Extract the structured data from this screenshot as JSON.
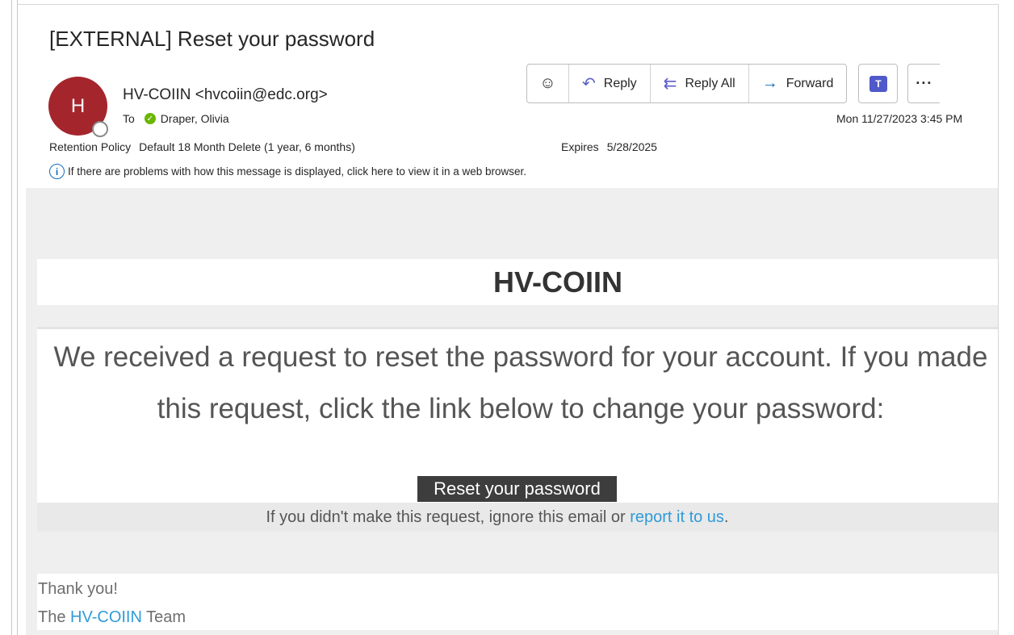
{
  "message": {
    "subject": "[EXTERNAL] Reset your password",
    "sender_initial": "H",
    "sender": "HV-COIIN <hvcoiin@edc.org>",
    "to_label": "To",
    "to_name": "Draper, Olivia",
    "date": "Mon 11/27/2023 3:45 PM",
    "retention_label": "Retention Policy",
    "retention_value": "Default 18 Month Delete (1 year, 6 months)",
    "expires_label": "Expires",
    "expires_value": "5/28/2025",
    "info_text": "If there are problems with how this message is displayed, click here to view it in a web browser."
  },
  "toolbar": {
    "reply_label": "Reply",
    "reply_all_label": "Reply All",
    "forward_label": "Forward",
    "more_label": "···"
  },
  "email_body": {
    "brand_title": "HV-COIIN",
    "main_text": "We received a request to reset the password for your account. If you made this request, click the link below to change your password:",
    "reset_link": "Reset your password",
    "ignore_prefix": "If you didn't make this request, ignore this email or ",
    "report_link": "report it to us",
    "ignore_suffix": ".",
    "thanks": "Thank you!",
    "team_prefix": "The ",
    "team_link": "HV-COIIN",
    "team_suffix": " Team"
  },
  "colors": {
    "avatar": "#a4262c",
    "link": "#2f9bd8",
    "reset_button": "#3d3d3d",
    "presence_check": "#6bb700"
  },
  "icons": [
    "emoji-icon",
    "reply-icon",
    "reply-all-icon",
    "forward-icon",
    "teams-icon",
    "more-icon",
    "info-icon",
    "check-icon"
  ]
}
